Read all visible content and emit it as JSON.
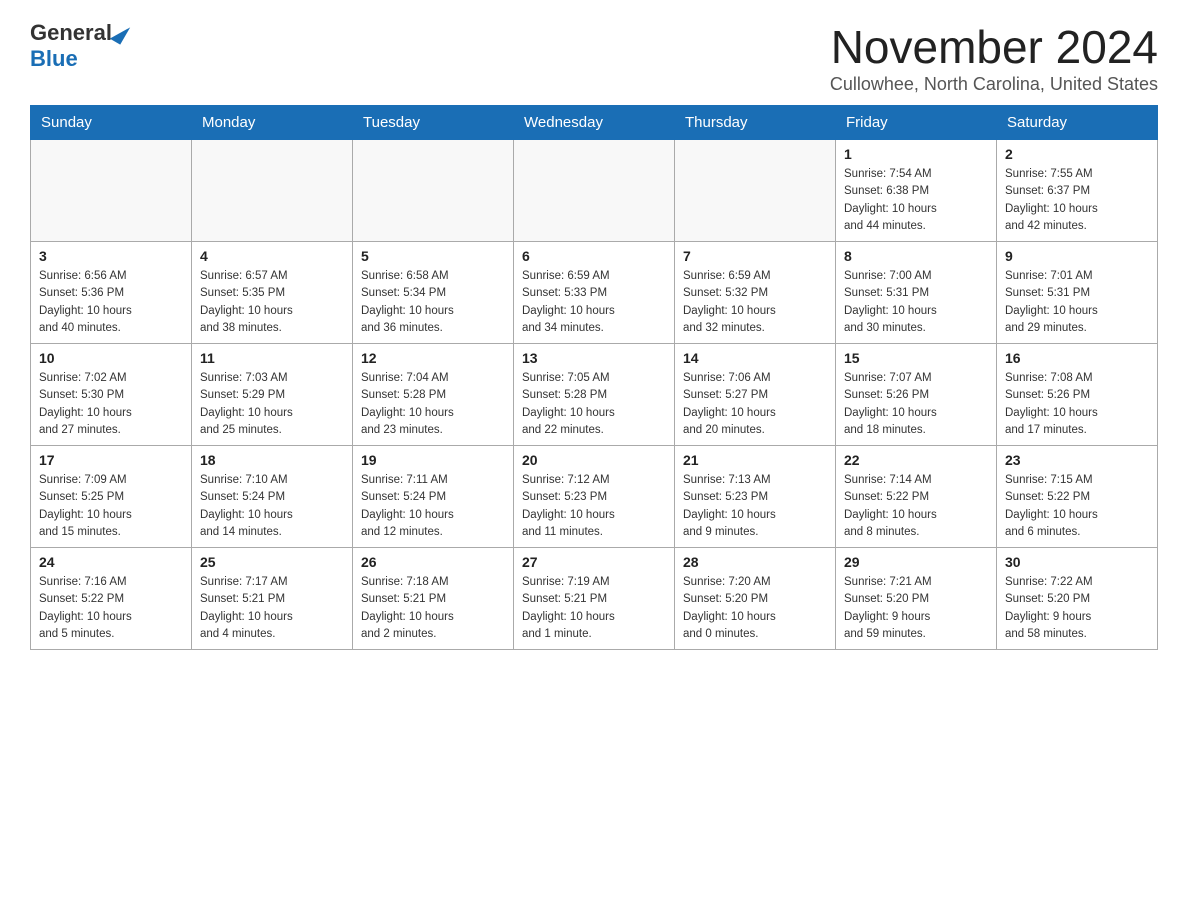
{
  "logo": {
    "general": "General",
    "blue": "Blue"
  },
  "title": "November 2024",
  "subtitle": "Cullowhee, North Carolina, United States",
  "days_of_week": [
    "Sunday",
    "Monday",
    "Tuesday",
    "Wednesday",
    "Thursday",
    "Friday",
    "Saturday"
  ],
  "weeks": [
    [
      {
        "day": "",
        "info": ""
      },
      {
        "day": "",
        "info": ""
      },
      {
        "day": "",
        "info": ""
      },
      {
        "day": "",
        "info": ""
      },
      {
        "day": "",
        "info": ""
      },
      {
        "day": "1",
        "info": "Sunrise: 7:54 AM\nSunset: 6:38 PM\nDaylight: 10 hours\nand 44 minutes."
      },
      {
        "day": "2",
        "info": "Sunrise: 7:55 AM\nSunset: 6:37 PM\nDaylight: 10 hours\nand 42 minutes."
      }
    ],
    [
      {
        "day": "3",
        "info": "Sunrise: 6:56 AM\nSunset: 5:36 PM\nDaylight: 10 hours\nand 40 minutes."
      },
      {
        "day": "4",
        "info": "Sunrise: 6:57 AM\nSunset: 5:35 PM\nDaylight: 10 hours\nand 38 minutes."
      },
      {
        "day": "5",
        "info": "Sunrise: 6:58 AM\nSunset: 5:34 PM\nDaylight: 10 hours\nand 36 minutes."
      },
      {
        "day": "6",
        "info": "Sunrise: 6:59 AM\nSunset: 5:33 PM\nDaylight: 10 hours\nand 34 minutes."
      },
      {
        "day": "7",
        "info": "Sunrise: 6:59 AM\nSunset: 5:32 PM\nDaylight: 10 hours\nand 32 minutes."
      },
      {
        "day": "8",
        "info": "Sunrise: 7:00 AM\nSunset: 5:31 PM\nDaylight: 10 hours\nand 30 minutes."
      },
      {
        "day": "9",
        "info": "Sunrise: 7:01 AM\nSunset: 5:31 PM\nDaylight: 10 hours\nand 29 minutes."
      }
    ],
    [
      {
        "day": "10",
        "info": "Sunrise: 7:02 AM\nSunset: 5:30 PM\nDaylight: 10 hours\nand 27 minutes."
      },
      {
        "day": "11",
        "info": "Sunrise: 7:03 AM\nSunset: 5:29 PM\nDaylight: 10 hours\nand 25 minutes."
      },
      {
        "day": "12",
        "info": "Sunrise: 7:04 AM\nSunset: 5:28 PM\nDaylight: 10 hours\nand 23 minutes."
      },
      {
        "day": "13",
        "info": "Sunrise: 7:05 AM\nSunset: 5:28 PM\nDaylight: 10 hours\nand 22 minutes."
      },
      {
        "day": "14",
        "info": "Sunrise: 7:06 AM\nSunset: 5:27 PM\nDaylight: 10 hours\nand 20 minutes."
      },
      {
        "day": "15",
        "info": "Sunrise: 7:07 AM\nSunset: 5:26 PM\nDaylight: 10 hours\nand 18 minutes."
      },
      {
        "day": "16",
        "info": "Sunrise: 7:08 AM\nSunset: 5:26 PM\nDaylight: 10 hours\nand 17 minutes."
      }
    ],
    [
      {
        "day": "17",
        "info": "Sunrise: 7:09 AM\nSunset: 5:25 PM\nDaylight: 10 hours\nand 15 minutes."
      },
      {
        "day": "18",
        "info": "Sunrise: 7:10 AM\nSunset: 5:24 PM\nDaylight: 10 hours\nand 14 minutes."
      },
      {
        "day": "19",
        "info": "Sunrise: 7:11 AM\nSunset: 5:24 PM\nDaylight: 10 hours\nand 12 minutes."
      },
      {
        "day": "20",
        "info": "Sunrise: 7:12 AM\nSunset: 5:23 PM\nDaylight: 10 hours\nand 11 minutes."
      },
      {
        "day": "21",
        "info": "Sunrise: 7:13 AM\nSunset: 5:23 PM\nDaylight: 10 hours\nand 9 minutes."
      },
      {
        "day": "22",
        "info": "Sunrise: 7:14 AM\nSunset: 5:22 PM\nDaylight: 10 hours\nand 8 minutes."
      },
      {
        "day": "23",
        "info": "Sunrise: 7:15 AM\nSunset: 5:22 PM\nDaylight: 10 hours\nand 6 minutes."
      }
    ],
    [
      {
        "day": "24",
        "info": "Sunrise: 7:16 AM\nSunset: 5:22 PM\nDaylight: 10 hours\nand 5 minutes."
      },
      {
        "day": "25",
        "info": "Sunrise: 7:17 AM\nSunset: 5:21 PM\nDaylight: 10 hours\nand 4 minutes."
      },
      {
        "day": "26",
        "info": "Sunrise: 7:18 AM\nSunset: 5:21 PM\nDaylight: 10 hours\nand 2 minutes."
      },
      {
        "day": "27",
        "info": "Sunrise: 7:19 AM\nSunset: 5:21 PM\nDaylight: 10 hours\nand 1 minute."
      },
      {
        "day": "28",
        "info": "Sunrise: 7:20 AM\nSunset: 5:20 PM\nDaylight: 10 hours\nand 0 minutes."
      },
      {
        "day": "29",
        "info": "Sunrise: 7:21 AM\nSunset: 5:20 PM\nDaylight: 9 hours\nand 59 minutes."
      },
      {
        "day": "30",
        "info": "Sunrise: 7:22 AM\nSunset: 5:20 PM\nDaylight: 9 hours\nand 58 minutes."
      }
    ]
  ]
}
